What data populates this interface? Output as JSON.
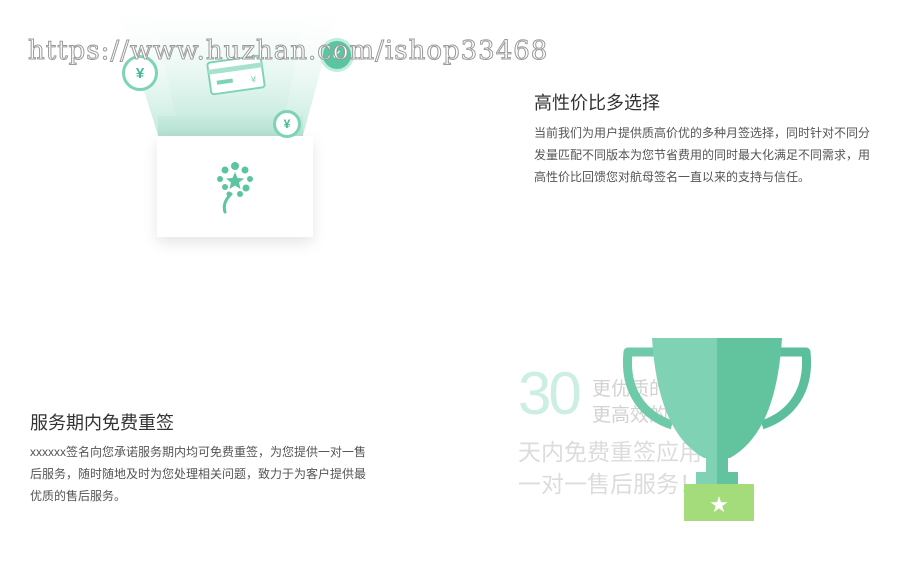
{
  "watermark": {
    "text": "https://www.huzhan.com/ishop33468"
  },
  "section_value": {
    "title": "高性价比多选择",
    "description": "当前我们为用户提供质高价优的多种月签选择，同时针对不同分发量匹配不同版本为您节省费用的同时最大化满足不同需求，用高性价比回馈您对航母签名一直以来的支持与信任。"
  },
  "section_service": {
    "title": "服务期内免费重签",
    "description": "xxxxxx签名向您承诺服务期内均可免费重签，为您提供一对一售后服务，随时随地及时为您处理相关问题，致力于为客户提供最优质的售后服务。"
  },
  "illustration_money": {
    "coin_symbol": "¥",
    "card_symbol": "¥"
  },
  "illustration_trophy": {
    "number": "30",
    "line1": "更优质的",
    "line2": "更高效的",
    "line3": "天内免费重签应用",
    "line4": "一对一售后服务！",
    "star": "★"
  },
  "colors": {
    "accent": "#5bc4a0",
    "trophy_base": "#a4dc7c",
    "text_dark": "#333333",
    "text_body": "#555555"
  }
}
